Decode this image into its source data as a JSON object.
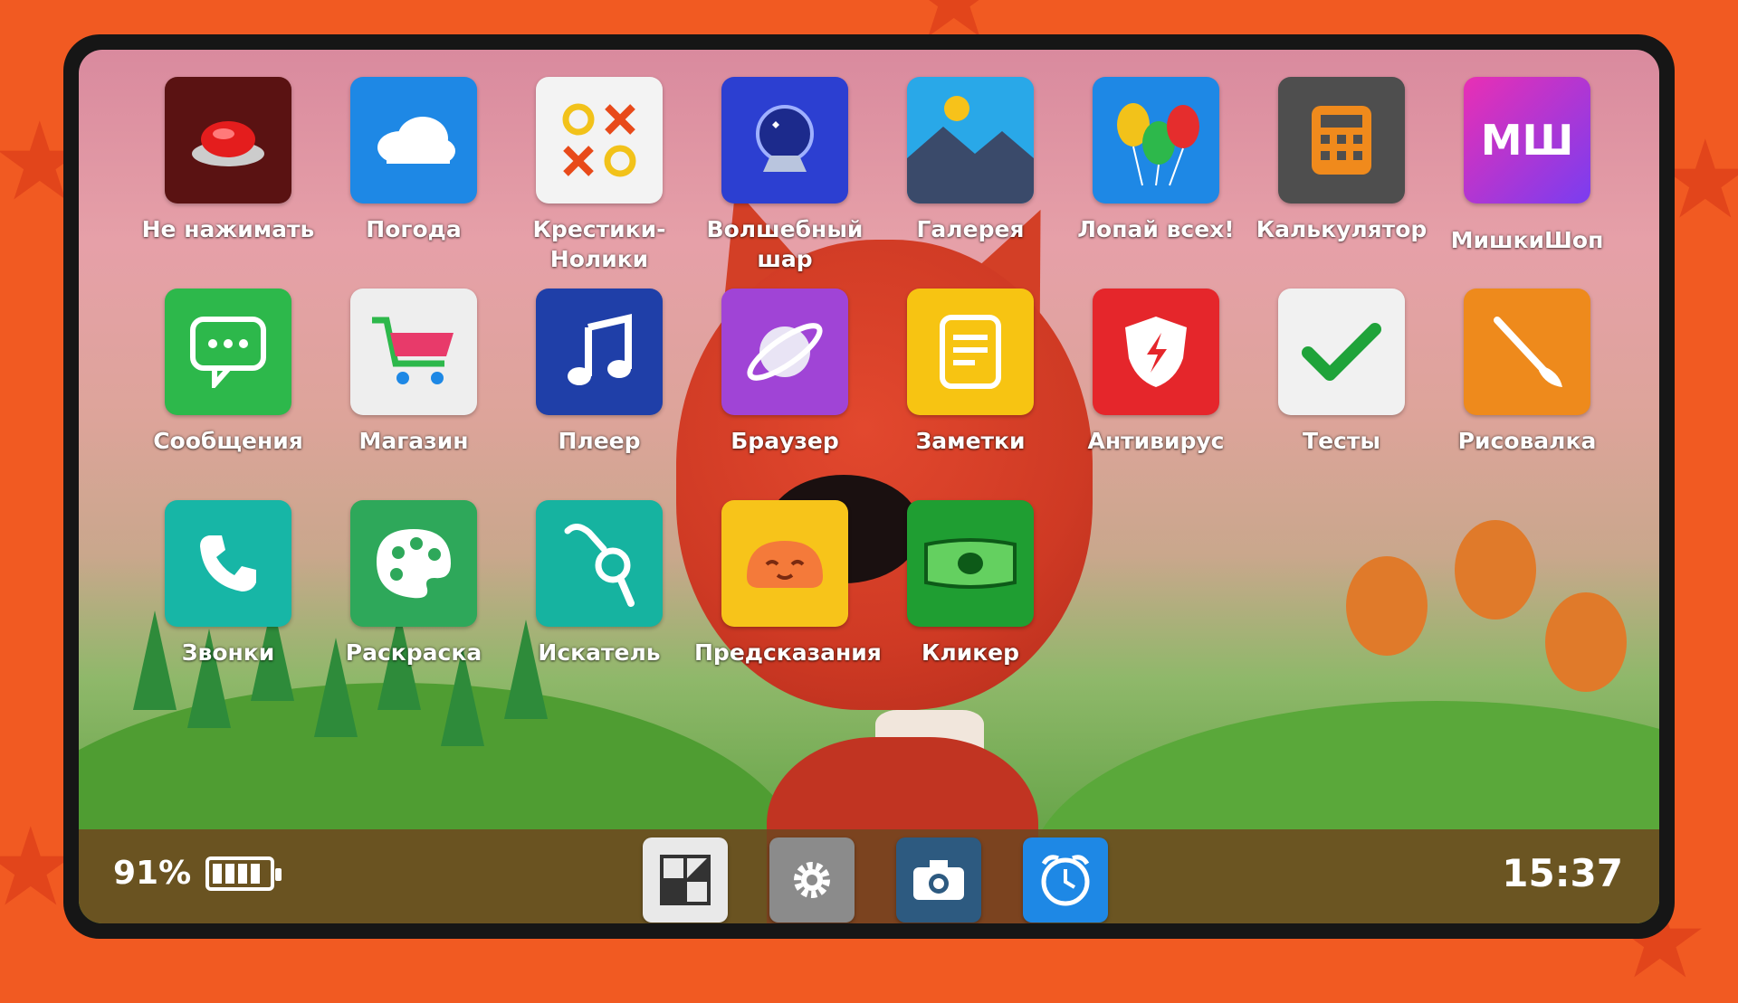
{
  "apps": [
    {
      "label": "Не нажимать",
      "icon": "red-button-icon",
      "bg": "#5a1212"
    },
    {
      "label": "Погода",
      "icon": "cloud-icon",
      "bg": "#1e88e5"
    },
    {
      "label": "Крестики-Нолики",
      "icon": "tic-tac-toe-icon",
      "bg": "#f3f3f3"
    },
    {
      "label": "Волшебный шар",
      "icon": "magic-ball-icon",
      "bg": "#2c3fd1"
    },
    {
      "label": "Галерея",
      "icon": "mountain-picture-icon",
      "bg": "#29a8e8"
    },
    {
      "label": "Лопай всех!",
      "icon": "balloons-icon",
      "bg": "#1e88e5"
    },
    {
      "label": "Калькулятор",
      "icon": "calculator-icon",
      "bg": "#4e4e4e"
    },
    {
      "label": "МишкиШоп",
      "icon": "mishki-shop-logo-icon",
      "bg": "#c42ec8",
      "text": "МШ"
    },
    {
      "label": "Сообщения",
      "icon": "chat-bubble-icon",
      "bg": "#2db84b"
    },
    {
      "label": "Магазин",
      "icon": "shopping-cart-icon",
      "bg": "#eeeeee"
    },
    {
      "label": "Плеер",
      "icon": "music-note-icon",
      "bg": "#1f3fa8"
    },
    {
      "label": "Браузер",
      "icon": "planet-icon",
      "bg": "#a044d6"
    },
    {
      "label": "Заметки",
      "icon": "notes-icon",
      "bg": "#f7c412"
    },
    {
      "label": "Антивирус",
      "icon": "shield-icon",
      "bg": "#e5262b"
    },
    {
      "label": "Тесты",
      "icon": "checkmark-icon",
      "bg": "#f1f1f1"
    },
    {
      "label": "Рисовалка",
      "icon": "paint-brush-icon",
      "bg": "#ee8a1c"
    },
    {
      "label": "Звонки",
      "icon": "phone-icon",
      "bg": "#17b6a6"
    },
    {
      "label": "Раскраска",
      "icon": "palette-icon",
      "bg": "#2ea85a"
    },
    {
      "label": "Искатель",
      "icon": "search-hand-icon",
      "bg": "#16b3a0"
    },
    {
      "label": "Предсказания",
      "icon": "happy-face-icon",
      "bg": "#f7c41a"
    },
    {
      "label": "Кликер",
      "icon": "money-bill-icon",
      "bg": "#1f9e32"
    }
  ],
  "status": {
    "battery_percent": "91%",
    "battery_level": 0.91,
    "time": "15:37"
  },
  "dock": [
    {
      "icon": "app-grid-icon",
      "bg": "#e9e9e9"
    },
    {
      "icon": "gear-icon",
      "bg": "#8b8b8b"
    },
    {
      "icon": "camera-icon",
      "bg": "#2d5a80"
    },
    {
      "icon": "alarm-clock-icon",
      "bg": "#1e88e5"
    }
  ]
}
